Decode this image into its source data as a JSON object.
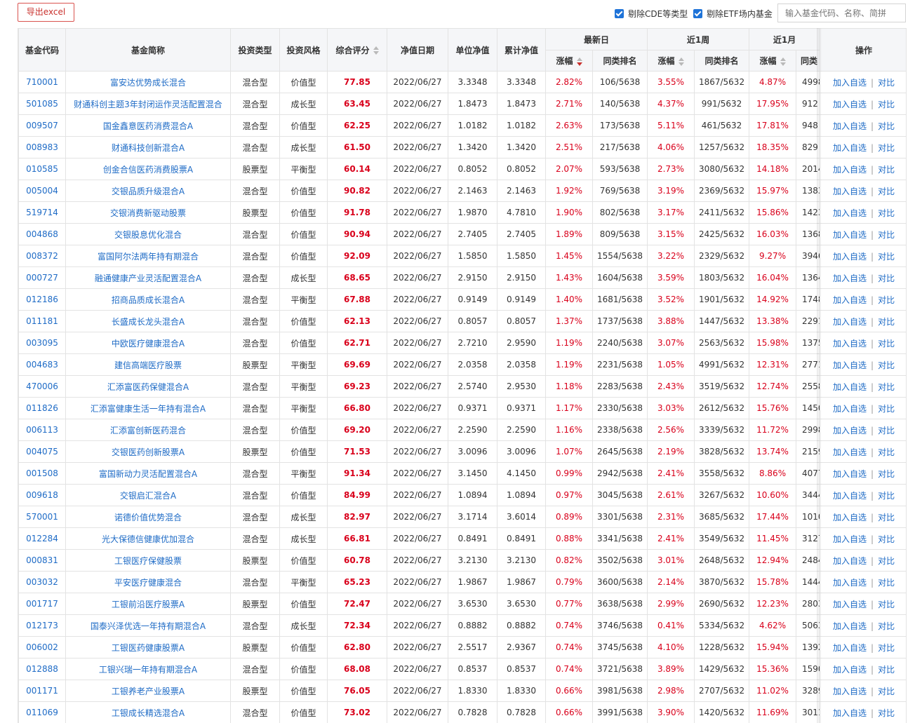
{
  "toolbar": {
    "export_label": "导出excel",
    "exclude_cde_label": "剔除CDE等类型",
    "exclude_etf_label": "剔除ETF场内基金",
    "search_placeholder": "输入基金代码、名称、简拼"
  },
  "table": {
    "headers": {
      "code": "基金代码",
      "name": "基金简称",
      "type": "投资类型",
      "style": "投资风格",
      "score": "综合评分",
      "date": "净值日期",
      "nav": "单位净值",
      "acc_nav": "累计净值",
      "group_1d": "最新日",
      "group_1w": "近1周",
      "group_1m": "近1月",
      "change": "涨幅",
      "rank": "同类排名",
      "rank_cut": "同类",
      "ops": "操作"
    },
    "op_add": "加入自选",
    "op_sep": "|",
    "op_compare": "对比",
    "rows": [
      {
        "code": "710001",
        "name": "富安达优势成长混合",
        "type": "混合型",
        "style": "价值型",
        "score": "77.85",
        "date": "2022/06/27",
        "nav": "3.3348",
        "acc": "3.3348",
        "d1": "2.82%",
        "d1r": "106/5638",
        "w1": "3.55%",
        "w1r": "1867/5632",
        "m1": "4.87%",
        "m1r": "4998"
      },
      {
        "code": "501085",
        "name": "财通科创主题3年封闭运作灵活配置混合",
        "type": "混合型",
        "style": "成长型",
        "score": "63.45",
        "date": "2022/06/27",
        "nav": "1.8473",
        "acc": "1.8473",
        "d1": "2.71%",
        "d1r": "140/5638",
        "w1": "4.37%",
        "w1r": "991/5632",
        "m1": "17.95%",
        "m1r": "912"
      },
      {
        "code": "009507",
        "name": "国金鑫意医药消费混合A",
        "type": "混合型",
        "style": "价值型",
        "score": "62.25",
        "date": "2022/06/27",
        "nav": "1.0182",
        "acc": "1.0182",
        "d1": "2.63%",
        "d1r": "173/5638",
        "w1": "5.11%",
        "w1r": "461/5632",
        "m1": "17.81%",
        "m1r": "948"
      },
      {
        "code": "008983",
        "name": "财通科技创新混合A",
        "type": "混合型",
        "style": "成长型",
        "score": "61.50",
        "date": "2022/06/27",
        "nav": "1.3420",
        "acc": "1.3420",
        "d1": "2.51%",
        "d1r": "217/5638",
        "w1": "4.06%",
        "w1r": "1257/5632",
        "m1": "18.35%",
        "m1r": "829"
      },
      {
        "code": "010585",
        "name": "创金合信医药消费股票A",
        "type": "股票型",
        "style": "平衡型",
        "score": "60.14",
        "date": "2022/06/27",
        "nav": "0.8052",
        "acc": "0.8052",
        "d1": "2.07%",
        "d1r": "593/5638",
        "w1": "2.73%",
        "w1r": "3080/5632",
        "m1": "14.18%",
        "m1r": "2014"
      },
      {
        "code": "005004",
        "name": "交银品质升级混合A",
        "type": "混合型",
        "style": "价值型",
        "score": "90.82",
        "date": "2022/06/27",
        "nav": "2.1463",
        "acc": "2.1463",
        "d1": "1.92%",
        "d1r": "769/5638",
        "w1": "3.19%",
        "w1r": "2369/5632",
        "m1": "15.97%",
        "m1r": "1383"
      },
      {
        "code": "519714",
        "name": "交银消费新驱动股票",
        "type": "股票型",
        "style": "价值型",
        "score": "91.78",
        "date": "2022/06/27",
        "nav": "1.9870",
        "acc": "4.7810",
        "d1": "1.90%",
        "d1r": "802/5638",
        "w1": "3.17%",
        "w1r": "2411/5632",
        "m1": "15.86%",
        "m1r": "1423"
      },
      {
        "code": "004868",
        "name": "交银股息优化混合",
        "type": "混合型",
        "style": "价值型",
        "score": "90.94",
        "date": "2022/06/27",
        "nav": "2.7405",
        "acc": "2.7405",
        "d1": "1.89%",
        "d1r": "809/5638",
        "w1": "3.15%",
        "w1r": "2425/5632",
        "m1": "16.03%",
        "m1r": "1368"
      },
      {
        "code": "008372",
        "name": "富国阿尔法两年持有期混合",
        "type": "混合型",
        "style": "价值型",
        "score": "92.09",
        "date": "2022/06/27",
        "nav": "1.5850",
        "acc": "1.5850",
        "d1": "1.45%",
        "d1r": "1554/5638",
        "w1": "3.22%",
        "w1r": "2329/5632",
        "m1": "9.27%",
        "m1r": "3946"
      },
      {
        "code": "000727",
        "name": "融通健康产业灵活配置混合A",
        "type": "混合型",
        "style": "成长型",
        "score": "68.65",
        "date": "2022/06/27",
        "nav": "2.9150",
        "acc": "2.9150",
        "d1": "1.43%",
        "d1r": "1604/5638",
        "w1": "3.59%",
        "w1r": "1803/5632",
        "m1": "16.04%",
        "m1r": "1364"
      },
      {
        "code": "012186",
        "name": "招商品质成长混合A",
        "type": "混合型",
        "style": "平衡型",
        "score": "67.88",
        "date": "2022/06/27",
        "nav": "0.9149",
        "acc": "0.9149",
        "d1": "1.40%",
        "d1r": "1681/5638",
        "w1": "3.52%",
        "w1r": "1901/5632",
        "m1": "14.92%",
        "m1r": "1748"
      },
      {
        "code": "011181",
        "name": "长盛成长龙头混合A",
        "type": "混合型",
        "style": "价值型",
        "score": "62.13",
        "date": "2022/06/27",
        "nav": "0.8057",
        "acc": "0.8057",
        "d1": "1.37%",
        "d1r": "1737/5638",
        "w1": "3.88%",
        "w1r": "1447/5632",
        "m1": "13.38%",
        "m1r": "2291"
      },
      {
        "code": "003095",
        "name": "中欧医疗健康混合A",
        "type": "混合型",
        "style": "价值型",
        "score": "62.71",
        "date": "2022/06/27",
        "nav": "2.7210",
        "acc": "2.9590",
        "d1": "1.19%",
        "d1r": "2240/5638",
        "w1": "3.07%",
        "w1r": "2563/5632",
        "m1": "15.98%",
        "m1r": "1375"
      },
      {
        "code": "004683",
        "name": "建信高端医疗股票",
        "type": "股票型",
        "style": "平衡型",
        "score": "69.69",
        "date": "2022/06/27",
        "nav": "2.0358",
        "acc": "2.0358",
        "d1": "1.19%",
        "d1r": "2231/5638",
        "w1": "1.05%",
        "w1r": "4991/5632",
        "m1": "12.31%",
        "m1r": "2771"
      },
      {
        "code": "470006",
        "name": "汇添富医药保健混合A",
        "type": "混合型",
        "style": "平衡型",
        "score": "69.23",
        "date": "2022/06/27",
        "nav": "2.5740",
        "acc": "2.9530",
        "d1": "1.18%",
        "d1r": "2283/5638",
        "w1": "2.43%",
        "w1r": "3519/5632",
        "m1": "12.74%",
        "m1r": "2558"
      },
      {
        "code": "011826",
        "name": "汇添富健康生活一年持有混合A",
        "type": "混合型",
        "style": "平衡型",
        "score": "66.80",
        "date": "2022/06/27",
        "nav": "0.9371",
        "acc": "0.9371",
        "d1": "1.17%",
        "d1r": "2330/5638",
        "w1": "3.03%",
        "w1r": "2612/5632",
        "m1": "15.76%",
        "m1r": "1450"
      },
      {
        "code": "006113",
        "name": "汇添富创新医药混合",
        "type": "混合型",
        "style": "价值型",
        "score": "69.20",
        "date": "2022/06/27",
        "nav": "2.2590",
        "acc": "2.2590",
        "d1": "1.16%",
        "d1r": "2338/5638",
        "w1": "2.56%",
        "w1r": "3339/5632",
        "m1": "11.72%",
        "m1r": "2998"
      },
      {
        "code": "004075",
        "name": "交银医药创新股票A",
        "type": "股票型",
        "style": "价值型",
        "score": "71.53",
        "date": "2022/06/27",
        "nav": "3.0096",
        "acc": "3.0096",
        "d1": "1.07%",
        "d1r": "2645/5638",
        "w1": "2.19%",
        "w1r": "3828/5632",
        "m1": "13.74%",
        "m1r": "2159"
      },
      {
        "code": "001508",
        "name": "富国新动力灵活配置混合A",
        "type": "混合型",
        "style": "平衡型",
        "score": "91.34",
        "date": "2022/06/27",
        "nav": "3.1450",
        "acc": "4.1450",
        "d1": "0.99%",
        "d1r": "2942/5638",
        "w1": "2.41%",
        "w1r": "3558/5632",
        "m1": "8.86%",
        "m1r": "4077"
      },
      {
        "code": "009618",
        "name": "交银启汇混合A",
        "type": "混合型",
        "style": "价值型",
        "score": "84.99",
        "date": "2022/06/27",
        "nav": "1.0894",
        "acc": "1.0894",
        "d1": "0.97%",
        "d1r": "3045/5638",
        "w1": "2.61%",
        "w1r": "3267/5632",
        "m1": "10.60%",
        "m1r": "3444"
      },
      {
        "code": "570001",
        "name": "诺德价值优势混合",
        "type": "混合型",
        "style": "成长型",
        "score": "82.97",
        "date": "2022/06/27",
        "nav": "3.1714",
        "acc": "3.6014",
        "d1": "0.89%",
        "d1r": "3301/5638",
        "w1": "2.31%",
        "w1r": "3685/5632",
        "m1": "17.44%",
        "m1r": "1010"
      },
      {
        "code": "012284",
        "name": "光大保德信健康优加混合",
        "type": "混合型",
        "style": "成长型",
        "score": "66.81",
        "date": "2022/06/27",
        "nav": "0.8491",
        "acc": "0.8491",
        "d1": "0.88%",
        "d1r": "3341/5638",
        "w1": "2.41%",
        "w1r": "3549/5632",
        "m1": "11.45%",
        "m1r": "3127"
      },
      {
        "code": "000831",
        "name": "工银医疗保健股票",
        "type": "股票型",
        "style": "价值型",
        "score": "60.78",
        "date": "2022/06/27",
        "nav": "3.2130",
        "acc": "3.2130",
        "d1": "0.82%",
        "d1r": "3502/5638",
        "w1": "3.01%",
        "w1r": "2648/5632",
        "m1": "12.94%",
        "m1r": "2484"
      },
      {
        "code": "003032",
        "name": "平安医疗健康混合",
        "type": "混合型",
        "style": "平衡型",
        "score": "65.23",
        "date": "2022/06/27",
        "nav": "1.9867",
        "acc": "1.9867",
        "d1": "0.79%",
        "d1r": "3600/5638",
        "w1": "2.14%",
        "w1r": "3870/5632",
        "m1": "15.78%",
        "m1r": "1444"
      },
      {
        "code": "001717",
        "name": "工银前沿医疗股票A",
        "type": "股票型",
        "style": "价值型",
        "score": "72.47",
        "date": "2022/06/27",
        "nav": "3.6530",
        "acc": "3.6530",
        "d1": "0.77%",
        "d1r": "3638/5638",
        "w1": "2.99%",
        "w1r": "2690/5632",
        "m1": "12.23%",
        "m1r": "2803"
      },
      {
        "code": "012173",
        "name": "国泰兴泽优选一年持有期混合A",
        "type": "混合型",
        "style": "成长型",
        "score": "72.34",
        "date": "2022/06/27",
        "nav": "0.8882",
        "acc": "0.8882",
        "d1": "0.74%",
        "d1r": "3746/5638",
        "w1": "0.41%",
        "w1r": "5334/5632",
        "m1": "4.62%",
        "m1r": "5063"
      },
      {
        "code": "006002",
        "name": "工银医药健康股票A",
        "type": "股票型",
        "style": "价值型",
        "score": "62.80",
        "date": "2022/06/27",
        "nav": "2.5517",
        "acc": "2.9367",
        "d1": "0.74%",
        "d1r": "3745/5638",
        "w1": "4.10%",
        "w1r": "1228/5632",
        "m1": "15.94%",
        "m1r": "1392"
      },
      {
        "code": "012888",
        "name": "工银兴瑞一年持有期混合A",
        "type": "混合型",
        "style": "价值型",
        "score": "68.08",
        "date": "2022/06/27",
        "nav": "0.8537",
        "acc": "0.8537",
        "d1": "0.74%",
        "d1r": "3721/5638",
        "w1": "3.89%",
        "w1r": "1429/5632",
        "m1": "15.36%",
        "m1r": "1590"
      },
      {
        "code": "001171",
        "name": "工银养老产业股票A",
        "type": "股票型",
        "style": "价值型",
        "score": "76.05",
        "date": "2022/06/27",
        "nav": "1.8330",
        "acc": "1.8330",
        "d1": "0.66%",
        "d1r": "3981/5638",
        "w1": "2.98%",
        "w1r": "2707/5632",
        "m1": "11.02%",
        "m1r": "3289"
      },
      {
        "code": "011069",
        "name": "工银成长精选混合A",
        "type": "混合型",
        "style": "价值型",
        "score": "73.02",
        "date": "2022/06/27",
        "nav": "0.7828",
        "acc": "0.7828",
        "d1": "0.66%",
        "d1r": "3991/5638",
        "w1": "3.90%",
        "w1r": "1420/5632",
        "m1": "11.69%",
        "m1r": "3011"
      }
    ]
  }
}
